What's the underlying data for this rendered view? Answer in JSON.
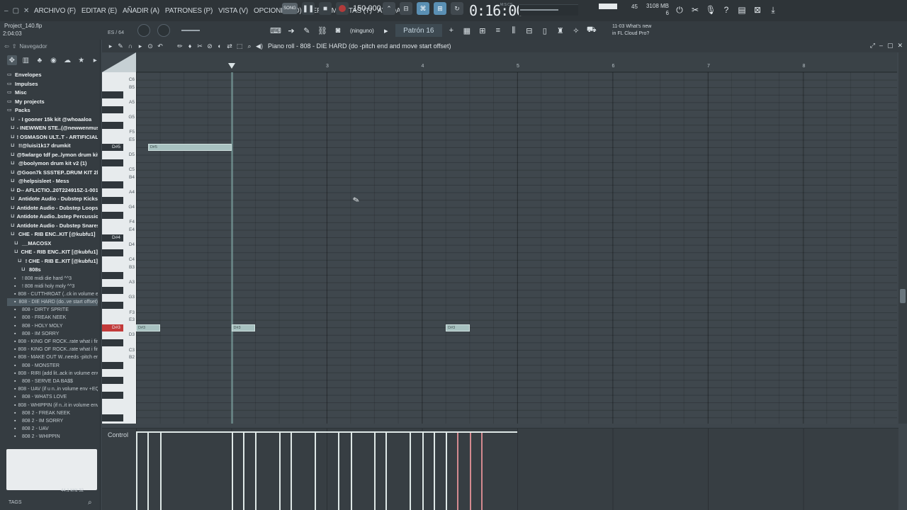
{
  "window": {
    "controls": [
      "–",
      "▢",
      "✕"
    ]
  },
  "menu": {
    "items": [
      "ARCHIVO (F)",
      "EDITAR (E)",
      "AÑADIR (A)",
      "PATRONES (P)",
      "VISTA (V)",
      "OPCIONES (O)",
      "HERRAMIENTAS (T)",
      "AYUDA"
    ]
  },
  "transport": {
    "song_label": "SONG",
    "tempo": "150.000",
    "time": "0:16:00",
    "time_unit": "M:S:CS",
    "cpu_value": "45",
    "memory": "3108 MB",
    "voices": "6"
  },
  "toolbar2": {
    "project_name": "Project_140.flp",
    "project_time": "2:04:03",
    "es_label": "ES / 64",
    "pattern_selector": "(ninguno)",
    "pattern_name": "Patrón 16",
    "news_date": "11-03",
    "news_title": "What's new",
    "news_subtitle": "in FL Cloud Pro?"
  },
  "browser": {
    "title": "Navegador",
    "items": [
      {
        "label": "Envelopes",
        "level": 0,
        "style": "bold"
      },
      {
        "label": "Impulses",
        "level": 0,
        "style": "bold"
      },
      {
        "label": "Misc",
        "level": 0,
        "style": "bold"
      },
      {
        "label": "My projects",
        "level": 0,
        "style": "bold"
      },
      {
        "label": "Packs",
        "level": 0,
        "style": "bold"
      },
      {
        "label": "- I gooner 15k kit @whoaaloa",
        "level": 1,
        "style": "bold"
      },
      {
        "label": "- INEWWEN STE..(@newwenmus)",
        "level": 1,
        "style": "bold"
      },
      {
        "label": "! OSMASON ULT..T - ARTIFICIAL",
        "level": 1,
        "style": "bold"
      },
      {
        "label": "!!@luisi1k17 drumkit",
        "level": 1,
        "style": "bold"
      },
      {
        "label": "@5wlargo tdf pe..lymon drum kit",
        "level": 1,
        "style": "bold"
      },
      {
        "label": "@boolymon drum kit v2 (1)",
        "level": 1,
        "style": "bold"
      },
      {
        "label": "@Goon7k SSSTEP..DRUM KIT 2k26",
        "level": 1,
        "style": "bold"
      },
      {
        "label": "@helpsisleet - Mess",
        "level": 1,
        "style": "bold"
      },
      {
        "label": "D-- AFLICTIO..20T224915Z-1-001",
        "level": 1,
        "style": "bold"
      },
      {
        "label": "Antidote Audio - Dubstep Kicks",
        "level": 1,
        "style": "bold"
      },
      {
        "label": "Antidote Audio - Dubstep Loops",
        "level": 1,
        "style": "bold"
      },
      {
        "label": "Antidote Audio..bstep Percussion",
        "level": 1,
        "style": "bold"
      },
      {
        "label": "Antidote Audio - Dubstep Snares",
        "level": 1,
        "style": "bold"
      },
      {
        "label": "CHE - RIB ENC..KIT [@kubfu1]",
        "level": 1,
        "style": "bold"
      },
      {
        "label": "__MACOSX",
        "level": 2,
        "style": "bold"
      },
      {
        "label": "CHE - RIB ENC..KIT [@kubfu1]",
        "level": 2,
        "style": "bold"
      },
      {
        "label": "! CHE - RIB E..KIT [@kubfu1]",
        "level": 3,
        "style": "bold"
      },
      {
        "label": "808s",
        "level": 4,
        "style": "bold"
      },
      {
        "label": "! 808 midi die hard ^^3",
        "level": 2,
        "style": "dim"
      },
      {
        "label": "! 808 midi holy moly ^^3",
        "level": 2,
        "style": "dim"
      },
      {
        "label": "808 - CUTTHROAT (..ck in volume env)",
        "level": 2,
        "style": "dim"
      },
      {
        "label": "808 - DIE HARD (do..ve start offset)",
        "level": 2,
        "style": "dim-hl"
      },
      {
        "label": "808 - DIRTY SPRITE",
        "level": 2,
        "style": "dim"
      },
      {
        "label": "808 - FREAK NEEK",
        "level": 2,
        "style": "dim"
      },
      {
        "label": "808 - HOLY MOLY",
        "level": 2,
        "style": "dim"
      },
      {
        "label": "808 - IM SORRY",
        "level": 2,
        "style": "dim"
      },
      {
        "label": "808 - KING OF ROCK..rate what i find)",
        "level": 2,
        "style": "dim"
      },
      {
        "label": "808 - KING OF ROCK..rate what i find)",
        "level": 2,
        "style": "dim"
      },
      {
        "label": "808 - MAKE OUT W..needs -pitch env)",
        "level": 2,
        "style": "dim"
      },
      {
        "label": "808 - MONSTER",
        "level": 2,
        "style": "dim"
      },
      {
        "label": "808 - RIRI (add lit..ack in volume env)",
        "level": 2,
        "style": "dim"
      },
      {
        "label": "808 - SERVE DA BA$$",
        "level": 2,
        "style": "dim"
      },
      {
        "label": "808 - UAV (if u n..in volume env +EQ)",
        "level": 2,
        "style": "dim"
      },
      {
        "label": "808 - WHATS LOVE",
        "level": 2,
        "style": "dim"
      },
      {
        "label": "808 - WHIPPIN (if n..it in volume env)",
        "level": 2,
        "style": "dim"
      },
      {
        "label": "808 2 - FREAK NEEK",
        "level": 2,
        "style": "dim"
      },
      {
        "label": "808 2 - IM SORRY",
        "level": 2,
        "style": "dim"
      },
      {
        "label": "808 2 - UAV",
        "level": 2,
        "style": "dim"
      },
      {
        "label": "808 2 - WHIPPIN",
        "level": 2,
        "style": "dim"
      }
    ],
    "preview_info": "44.1 kHz 32",
    "tags_label": "TAGS"
  },
  "piano_roll": {
    "title": "Piano roll - 808 - DIE HARD (do -pitch end and move start offset)",
    "bar_numbers": [
      "3",
      "4",
      "5",
      "6",
      "7",
      "8"
    ],
    "key_labels": [
      "C6",
      "B5",
      "A5",
      "G5",
      "F5",
      "E5",
      "D#5",
      "D5",
      "C5",
      "B4",
      "A4",
      "G4",
      "F4",
      "E4",
      "D#4",
      "D4",
      "C4",
      "B3",
      "A3",
      "G3",
      "F3",
      "E3",
      "D#3",
      "D3",
      "C3",
      "B2"
    ],
    "notes": [
      {
        "pitch": "D#5",
        "label": "D#5",
        "start": 0.125,
        "length": 0.875
      },
      {
        "pitch": "D#3",
        "label": "D#3",
        "start": 0.0,
        "length": 0.25
      },
      {
        "pitch": "D#3",
        "label": "D#3",
        "start": 1.0,
        "length": 0.25
      },
      {
        "pitch": "D#3",
        "label": "D#3",
        "start": 3.25,
        "length": 0.25
      }
    ],
    "control_label": "Control",
    "highlight_key": "D#3"
  },
  "colors": {
    "accent": "#5a8fb3",
    "note": "#a7c1c0",
    "record": "#b23b3b",
    "highlight_key": "#c33a3a"
  }
}
